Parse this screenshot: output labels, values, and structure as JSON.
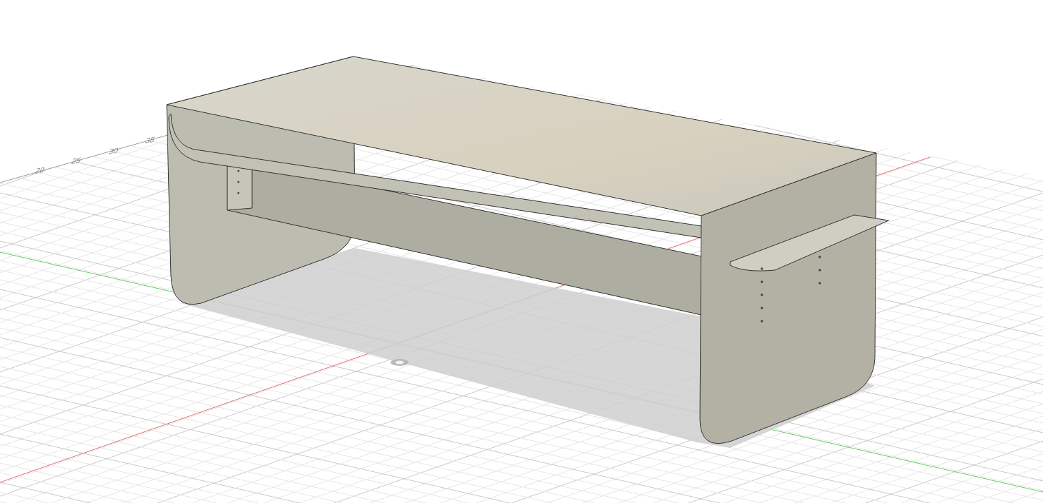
{
  "viewport": {
    "grid_labels": [
      "20",
      "25",
      "30",
      "35"
    ]
  }
}
